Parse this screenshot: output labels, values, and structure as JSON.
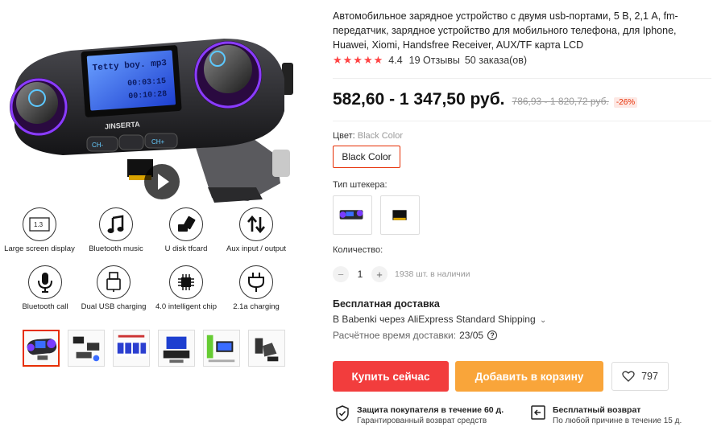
{
  "product": {
    "title": "Автомобильное зарядное устройство с двумя usb-портами, 5 В, 2,1 А, fm-передатчик, зарядное устройство для мобильного телефона, для Iphone, Huawei, Xiomi, Handsfree Receiver, AUX/TF карта LCD",
    "rating_value": "4.4",
    "reviews": "19 Отзывы",
    "orders": "50 заказа(ов)",
    "stars": "★★★★★",
    "price": "582,60 - 1 347,50 руб.",
    "old_price": "786,93 - 1 820,72 руб.",
    "discount": "-26%"
  },
  "gallery": {
    "screen_line1": "Tetty boy. mp3",
    "screen_line2": "00:03:15",
    "screen_line3": "00:10:28",
    "brand": "JINSERTA",
    "btn_ch_minus": "CH-",
    "btn_ch_plus": "CH+",
    "features": [
      {
        "label": "Large screen display",
        "icon": "screen-icon",
        "glyph": "1.3"
      },
      {
        "label": "Bluetooth music",
        "icon": "music-note-icon"
      },
      {
        "label": "U disk tfcard",
        "icon": "usb-disk-icon"
      },
      {
        "label": "Aux input / output",
        "icon": "up-down-arrows-icon"
      },
      {
        "label": "Bluetooth call",
        "icon": "microphone-icon"
      },
      {
        "label": "Dual USB charging",
        "icon": "usb-plug-icon"
      },
      {
        "label": "4.0 intelligent chip",
        "icon": "chip-icon"
      },
      {
        "label": "2.1a charging",
        "icon": "power-plug-icon"
      }
    ]
  },
  "options": {
    "color_label": "Цвет:",
    "color_value": "Black Color",
    "color_option": "Black Color",
    "plug_label": "Тип штекера:",
    "qty_label": "Количество:",
    "qty_minus": "−",
    "qty_value": "1",
    "qty_plus": "+",
    "stock": "1938 шт. в наличии"
  },
  "shipping": {
    "title": "Бесплатная доставка",
    "line": "В Babenki через AliExpress Standard Shipping",
    "chevron": "⌄",
    "eta_label": "Расчётное время доставки:",
    "eta_date": "23/05",
    "help": "?"
  },
  "actions": {
    "buy": "Купить сейчас",
    "cart": "Добавить в корзину",
    "wishlist_count": "797"
  },
  "guarantees": [
    {
      "title": "Защита покупателя в течение 60 д.",
      "sub": "Гарантированный возврат средств"
    },
    {
      "title": "Бесплатный возврат",
      "sub": "По любой причине в течение 15 д."
    }
  ],
  "colors": {
    "accent": "#e62e04",
    "buy": "#f23d3d",
    "cart": "#f9a53a",
    "stars": "#ff4444"
  }
}
